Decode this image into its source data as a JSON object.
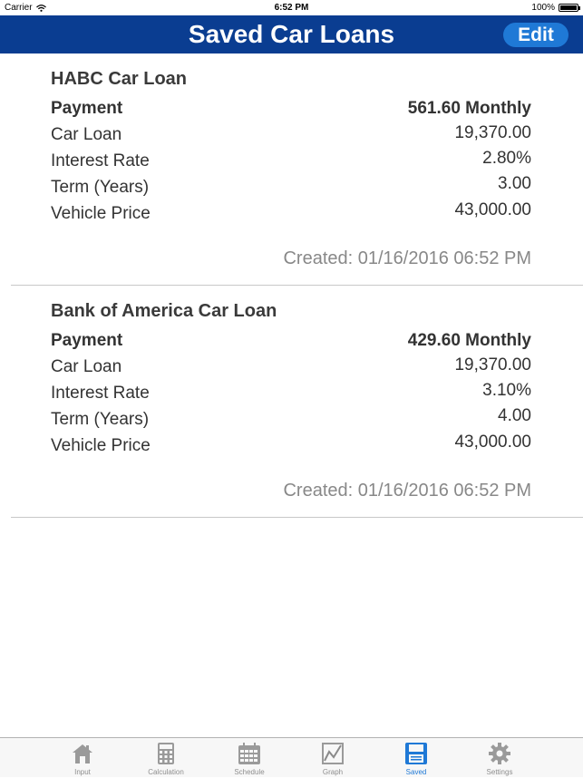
{
  "status_bar": {
    "carrier": "Carrier",
    "time": "6:52 PM",
    "battery": "100%"
  },
  "nav": {
    "title": "Saved Car Loans",
    "edit_label": "Edit"
  },
  "loans": [
    {
      "title": "HABC Car Loan",
      "rows": [
        {
          "label": "Payment",
          "value": "561.60 Monthly"
        },
        {
          "label": "Car Loan",
          "value": "19,370.00"
        },
        {
          "label": "Interest Rate",
          "value": "2.80%"
        },
        {
          "label": "Term (Years)",
          "value": "3.00"
        },
        {
          "label": "Vehicle Price",
          "value": "43,000.00"
        }
      ],
      "created": "Created: 01/16/2016 06:52 PM"
    },
    {
      "title": "Bank of America Car Loan",
      "rows": [
        {
          "label": "Payment",
          "value": "429.60 Monthly"
        },
        {
          "label": "Car Loan",
          "value": "19,370.00"
        },
        {
          "label": "Interest Rate",
          "value": "3.10%"
        },
        {
          "label": "Term (Years)",
          "value": "4.00"
        },
        {
          "label": "Vehicle Price",
          "value": "43,000.00"
        }
      ],
      "created": "Created: 01/16/2016 06:52 PM"
    }
  ],
  "tabs": [
    {
      "label": "Input",
      "icon": "house-icon"
    },
    {
      "label": "Calculation",
      "icon": "calculator-icon"
    },
    {
      "label": "Schedule",
      "icon": "calendar-icon"
    },
    {
      "label": "Graph",
      "icon": "graph-icon"
    },
    {
      "label": "Saved",
      "icon": "floppy-disk-icon",
      "active": true
    },
    {
      "label": "Settings",
      "icon": "gear-icon"
    }
  ],
  "colors": {
    "nav_bg": "#0a3d91",
    "accent": "#1f79d6",
    "tab_inactive": "#8e8e8e"
  }
}
